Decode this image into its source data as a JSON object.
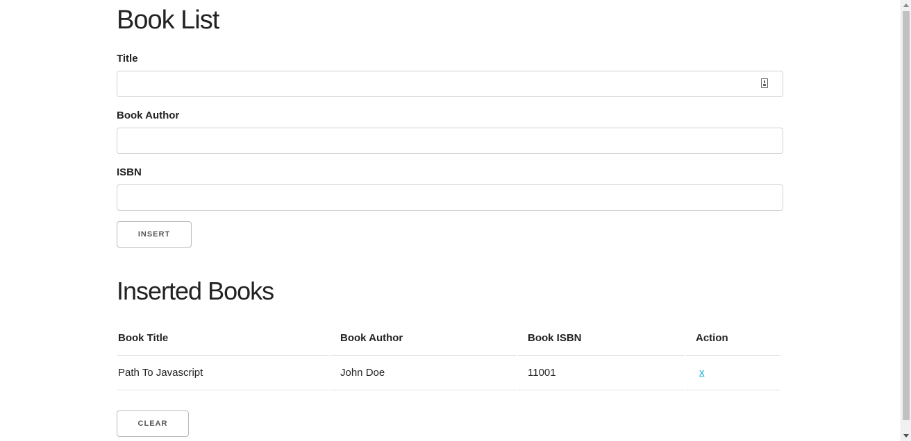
{
  "page": {
    "title": "Book List"
  },
  "form": {
    "title_label": "Title",
    "title_value": "",
    "author_label": "Book Author",
    "author_value": "",
    "isbn_label": "ISBN",
    "isbn_value": "",
    "insert_label": "INSERT"
  },
  "inserted": {
    "heading": "Inserted Books",
    "columns": [
      "Book Title",
      "Book Author",
      "Book ISBN",
      "Action"
    ],
    "rows": [
      {
        "title": "Path To Javascript",
        "author": "John Doe",
        "isbn": "11001",
        "action": "x"
      }
    ],
    "clear_label": "CLEAR"
  },
  "colors": {
    "link": "#1EAEDB",
    "text": "#222222",
    "border": "#d1d1d1"
  },
  "icons": {
    "autofill": "contact-card-icon",
    "scroll_up": "chevron-up-icon",
    "scroll_down": "chevron-down-icon"
  }
}
